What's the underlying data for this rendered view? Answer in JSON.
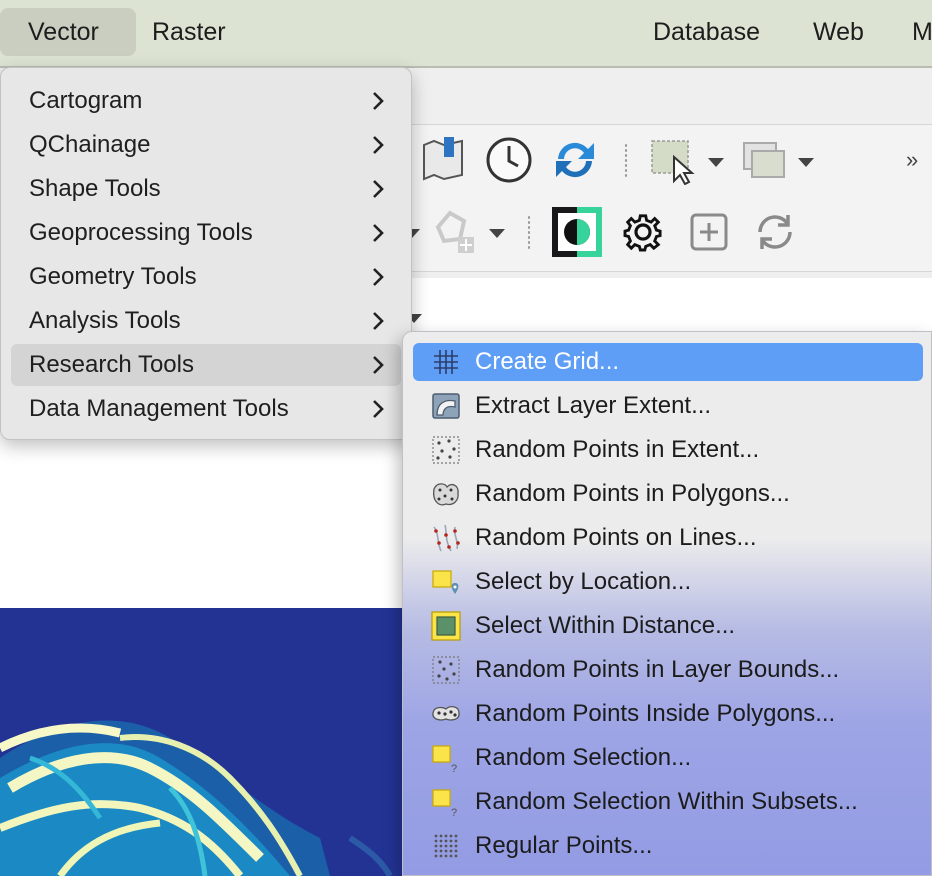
{
  "menubar": {
    "items": [
      {
        "label": "Vector",
        "icon": ""
      },
      {
        "label": "Raster"
      },
      {
        "label": "Database"
      },
      {
        "label": "Web"
      },
      {
        "label": "M"
      }
    ]
  },
  "toolbar": {
    "row1_icons": [
      "map-bookmark-icon",
      "clock-icon",
      "refresh-icon",
      "select-features-icon",
      "attribute-table-icon"
    ],
    "row2_icons": [
      "digitize-tool-icon",
      "contrast-plugin-icon",
      "settings-gear-icon",
      "add-plus-icon",
      "reload-icon"
    ],
    "overflow_label": "»"
  },
  "vector_menu": {
    "items": [
      {
        "label": "Cartogram"
      },
      {
        "label": "QChainage"
      },
      {
        "label": "Shape Tools"
      },
      {
        "label": "Geoprocessing Tools"
      },
      {
        "label": "Geometry Tools"
      },
      {
        "label": "Analysis Tools"
      },
      {
        "label": "Research Tools"
      },
      {
        "label": "Data Management Tools"
      }
    ],
    "highlighted": "Research Tools"
  },
  "research_submenu": {
    "items": [
      {
        "label": "Create Grid...",
        "icon": "grid-icon"
      },
      {
        "label": "Extract Layer Extent...",
        "icon": "layer-extent-icon"
      },
      {
        "label": "Random Points in Extent...",
        "icon": "random-points-extent-icon"
      },
      {
        "label": "Random Points in Polygons...",
        "icon": "random-points-polygons-icon"
      },
      {
        "label": "Random Points on Lines...",
        "icon": "random-points-lines-icon"
      },
      {
        "label": "Select by Location...",
        "icon": "select-location-icon"
      },
      {
        "label": "Select Within Distance...",
        "icon": "select-distance-icon"
      },
      {
        "label": "Random Points in Layer Bounds...",
        "icon": "random-points-bounds-icon"
      },
      {
        "label": "Random Points Inside Polygons...",
        "icon": "random-points-inside-icon"
      },
      {
        "label": "Random Selection...",
        "icon": "random-selection-icon"
      },
      {
        "label": "Random Selection Within Subsets...",
        "icon": "random-selection-subsets-icon"
      },
      {
        "label": "Regular Points...",
        "icon": "regular-points-icon"
      }
    ],
    "selected": "Create Grid...",
    "selection_color": "#5e9ef6"
  },
  "colors": {
    "menubar": "#dde3d3",
    "map_background": "#233394"
  }
}
